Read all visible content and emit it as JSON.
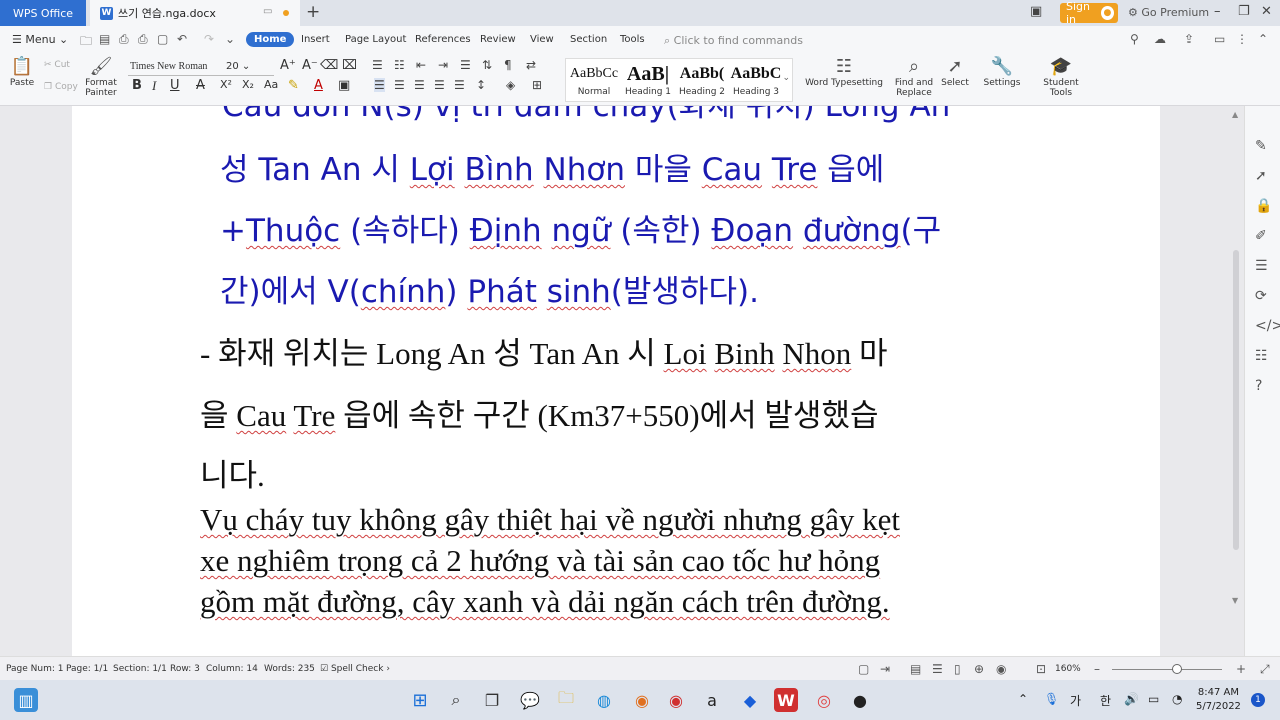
{
  "titlebar": {
    "app_tab": "WPS Office",
    "doc_tab": "쓰기 연습.nga.docx",
    "doc_icon_letter": "W",
    "signin": "Sign in",
    "premium": "Go Premium"
  },
  "menubar": {
    "menu_label": "Menu",
    "tabs": [
      "Home",
      "Insert",
      "Page Layout",
      "References",
      "Review",
      "View",
      "Section",
      "Tools"
    ],
    "find_commands": "Click to find commands"
  },
  "ribbon": {
    "paste": "Paste",
    "cut": "Cut",
    "copy": "Copy",
    "format_painter_1": "Format",
    "format_painter_2": "Painter",
    "font_name": "Times New Roman",
    "font_size": "20",
    "styles": [
      {
        "sample": "AaBbCc",
        "name": "Normal"
      },
      {
        "sample": "AaB|",
        "name": "Heading 1"
      },
      {
        "sample": "AaBb(",
        "name": "Heading 2"
      },
      {
        "sample": "AaBbC",
        "name": "Heading 3"
      }
    ],
    "word_typesetting": "Word Typesetting",
    "find_replace_1": "Find and",
    "find_replace_2": "Replace",
    "select": "Select",
    "settings": "Settings",
    "student_tools": "Student Tools"
  },
  "document": {
    "line1": "Cấu đơn N(s) vị trí đám cháy(화재 위치) Long An",
    "line2_parts": [
      "성 Tan An 시 ",
      "Lợi",
      " ",
      "Bình",
      " ",
      "Nhơn",
      " 마을 ",
      "Cau",
      " ",
      "Tre",
      " 읍에"
    ],
    "line3_parts": [
      "+",
      "Thuộc",
      " (속하다) ",
      "Định",
      " ",
      "ngữ",
      " (속한) ",
      "Đoạn",
      " ",
      "đường",
      "(구"
    ],
    "line4_parts": [
      "간)에서 V(",
      "chính",
      ") ",
      "Phát",
      " ",
      "sinh",
      "(발생하다)."
    ],
    "line5_parts": [
      "- 화재 위치는 Long An 성 Tan An 시 ",
      "Loi",
      " ",
      "Binh",
      " ",
      "Nhon",
      " 마"
    ],
    "line6_parts": [
      "을 ",
      "Cau",
      " ",
      "Tre",
      " 읍에 속한 구간 (Km37+550)에서 발생했습"
    ],
    "line7": "니다.",
    "line8": "Vụ cháy tuy không gây thiệt hại về người nhưng gây kẹt",
    "line9": "xe nghiêm trọng cả 2 hướng và tài sản cao tốc hư hỏng",
    "line10": "gồm mặt đường, cây xanh và dải ngăn cách trên đường."
  },
  "statusbar": {
    "page_num": "Page Num: 1",
    "page": "Page: 1/1",
    "section": "Section: 1/1",
    "row": "Row: 3",
    "column": "Column: 14",
    "words": "Words: 235",
    "spell_check": "Spell Check",
    "zoom": "160%"
  },
  "taskbar": {
    "ime_1": "가",
    "ime_2": "한",
    "time": "8:47 AM",
    "date": "5/7/2022",
    "notifications": "1"
  },
  "colors": {
    "accent": "#2f6fd0",
    "doc_blue_text": "#1a1ab0",
    "signin": "#f0a020"
  }
}
